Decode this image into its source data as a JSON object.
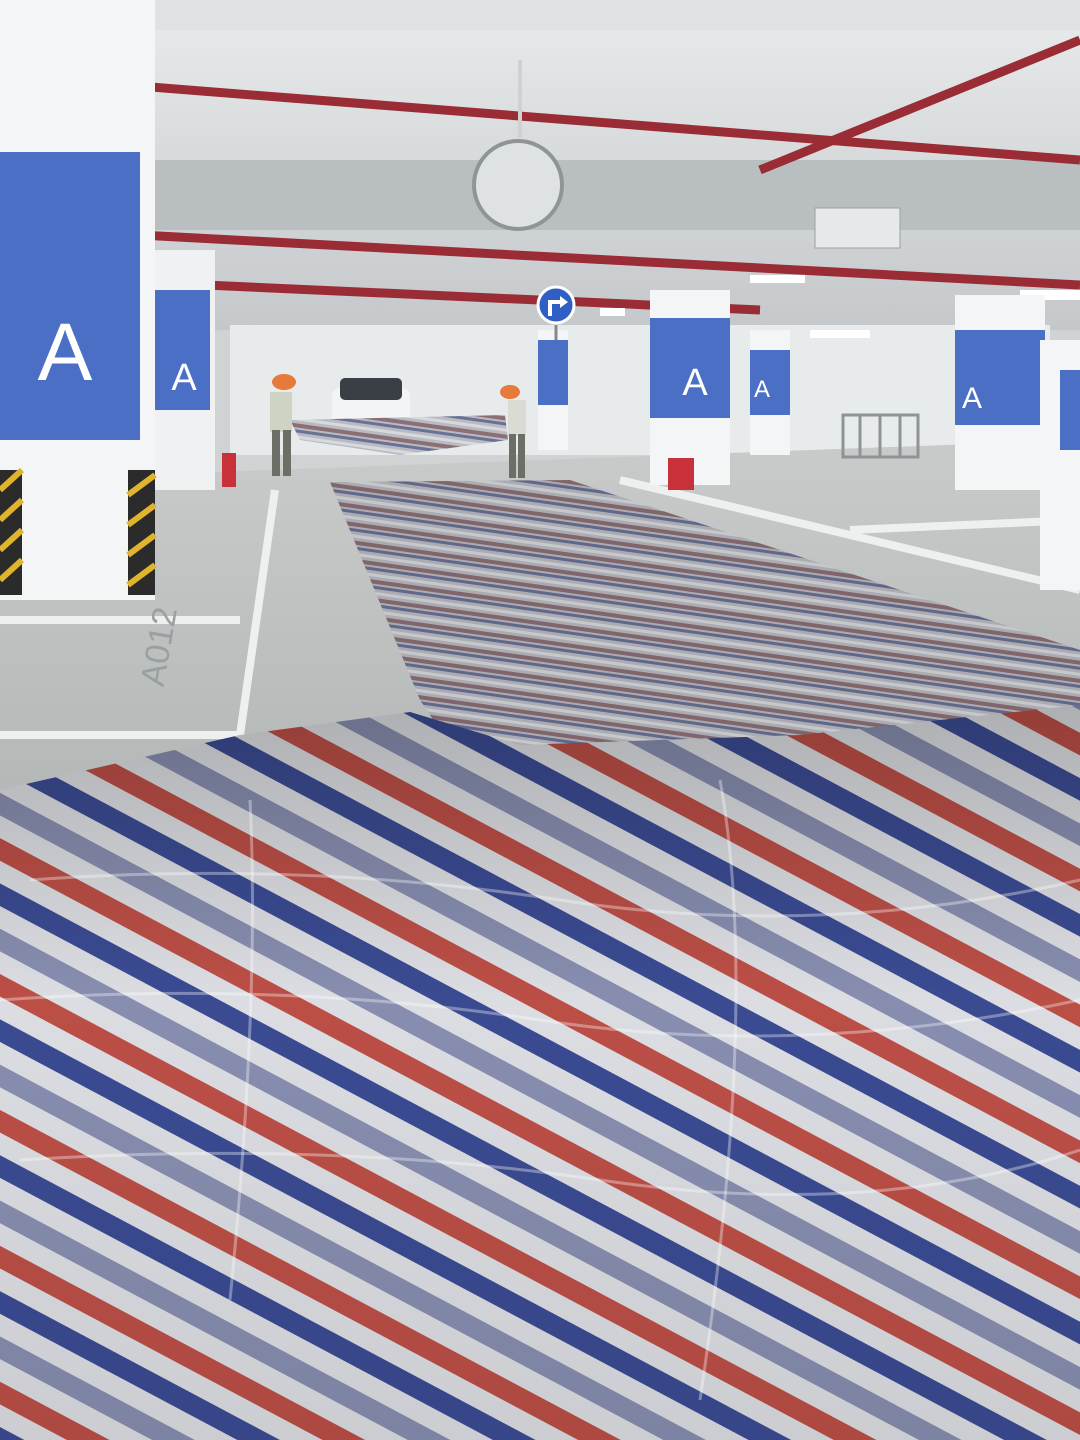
{
  "scene": {
    "pillar_letter": "A",
    "stall_number": "A012",
    "colors": {
      "pillar_blue": "#4a6fc4",
      "pipe_red": "#9a2c36",
      "tarp_red": "#c5534a",
      "tarp_blue": "#3e4f9a",
      "tarp_white": "#e7e9ee",
      "floor": "#a9adac",
      "ceiling": "#d7dadb",
      "sign_blue": "#2f5fc4"
    },
    "icons": [
      "turn-right-sign-icon",
      "convex-mirror"
    ]
  }
}
